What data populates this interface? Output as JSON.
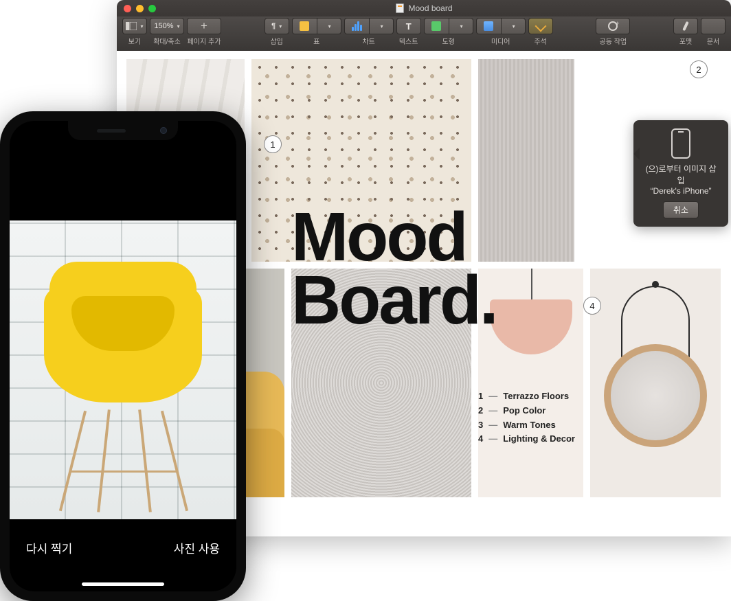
{
  "mac": {
    "window_title": "Mood board",
    "toolbar": {
      "view_label": "보기",
      "zoom_value": "150%",
      "zoom_label": "확대/축소",
      "add_page_label": "페이지 추가",
      "insert_label": "삽입",
      "table_label": "표",
      "chart_label": "차트",
      "text_label": "텍스트",
      "shape_label": "도형",
      "media_label": "미디어",
      "annotate_label": "주석",
      "collaborate_label": "공동 작업",
      "format_label": "포맷",
      "document_label": "문서"
    },
    "document": {
      "title_line1": "Mood",
      "title_line2": "Board.",
      "legend": [
        {
          "n": "1",
          "label": "Terrazzo Floors"
        },
        {
          "n": "2",
          "label": "Pop Color"
        },
        {
          "n": "3",
          "label": "Warm Tones"
        },
        {
          "n": "4",
          "label": "Lighting & Decor"
        }
      ],
      "callouts": {
        "c1": "1",
        "c2": "2",
        "c4": "4"
      }
    },
    "popover": {
      "line1": "(으)로부터 이미지 삽입",
      "device": "“Derek's iPhone”",
      "cancel": "취소"
    }
  },
  "iphone": {
    "retake": "다시 찍기",
    "use_photo": "사진 사용"
  }
}
